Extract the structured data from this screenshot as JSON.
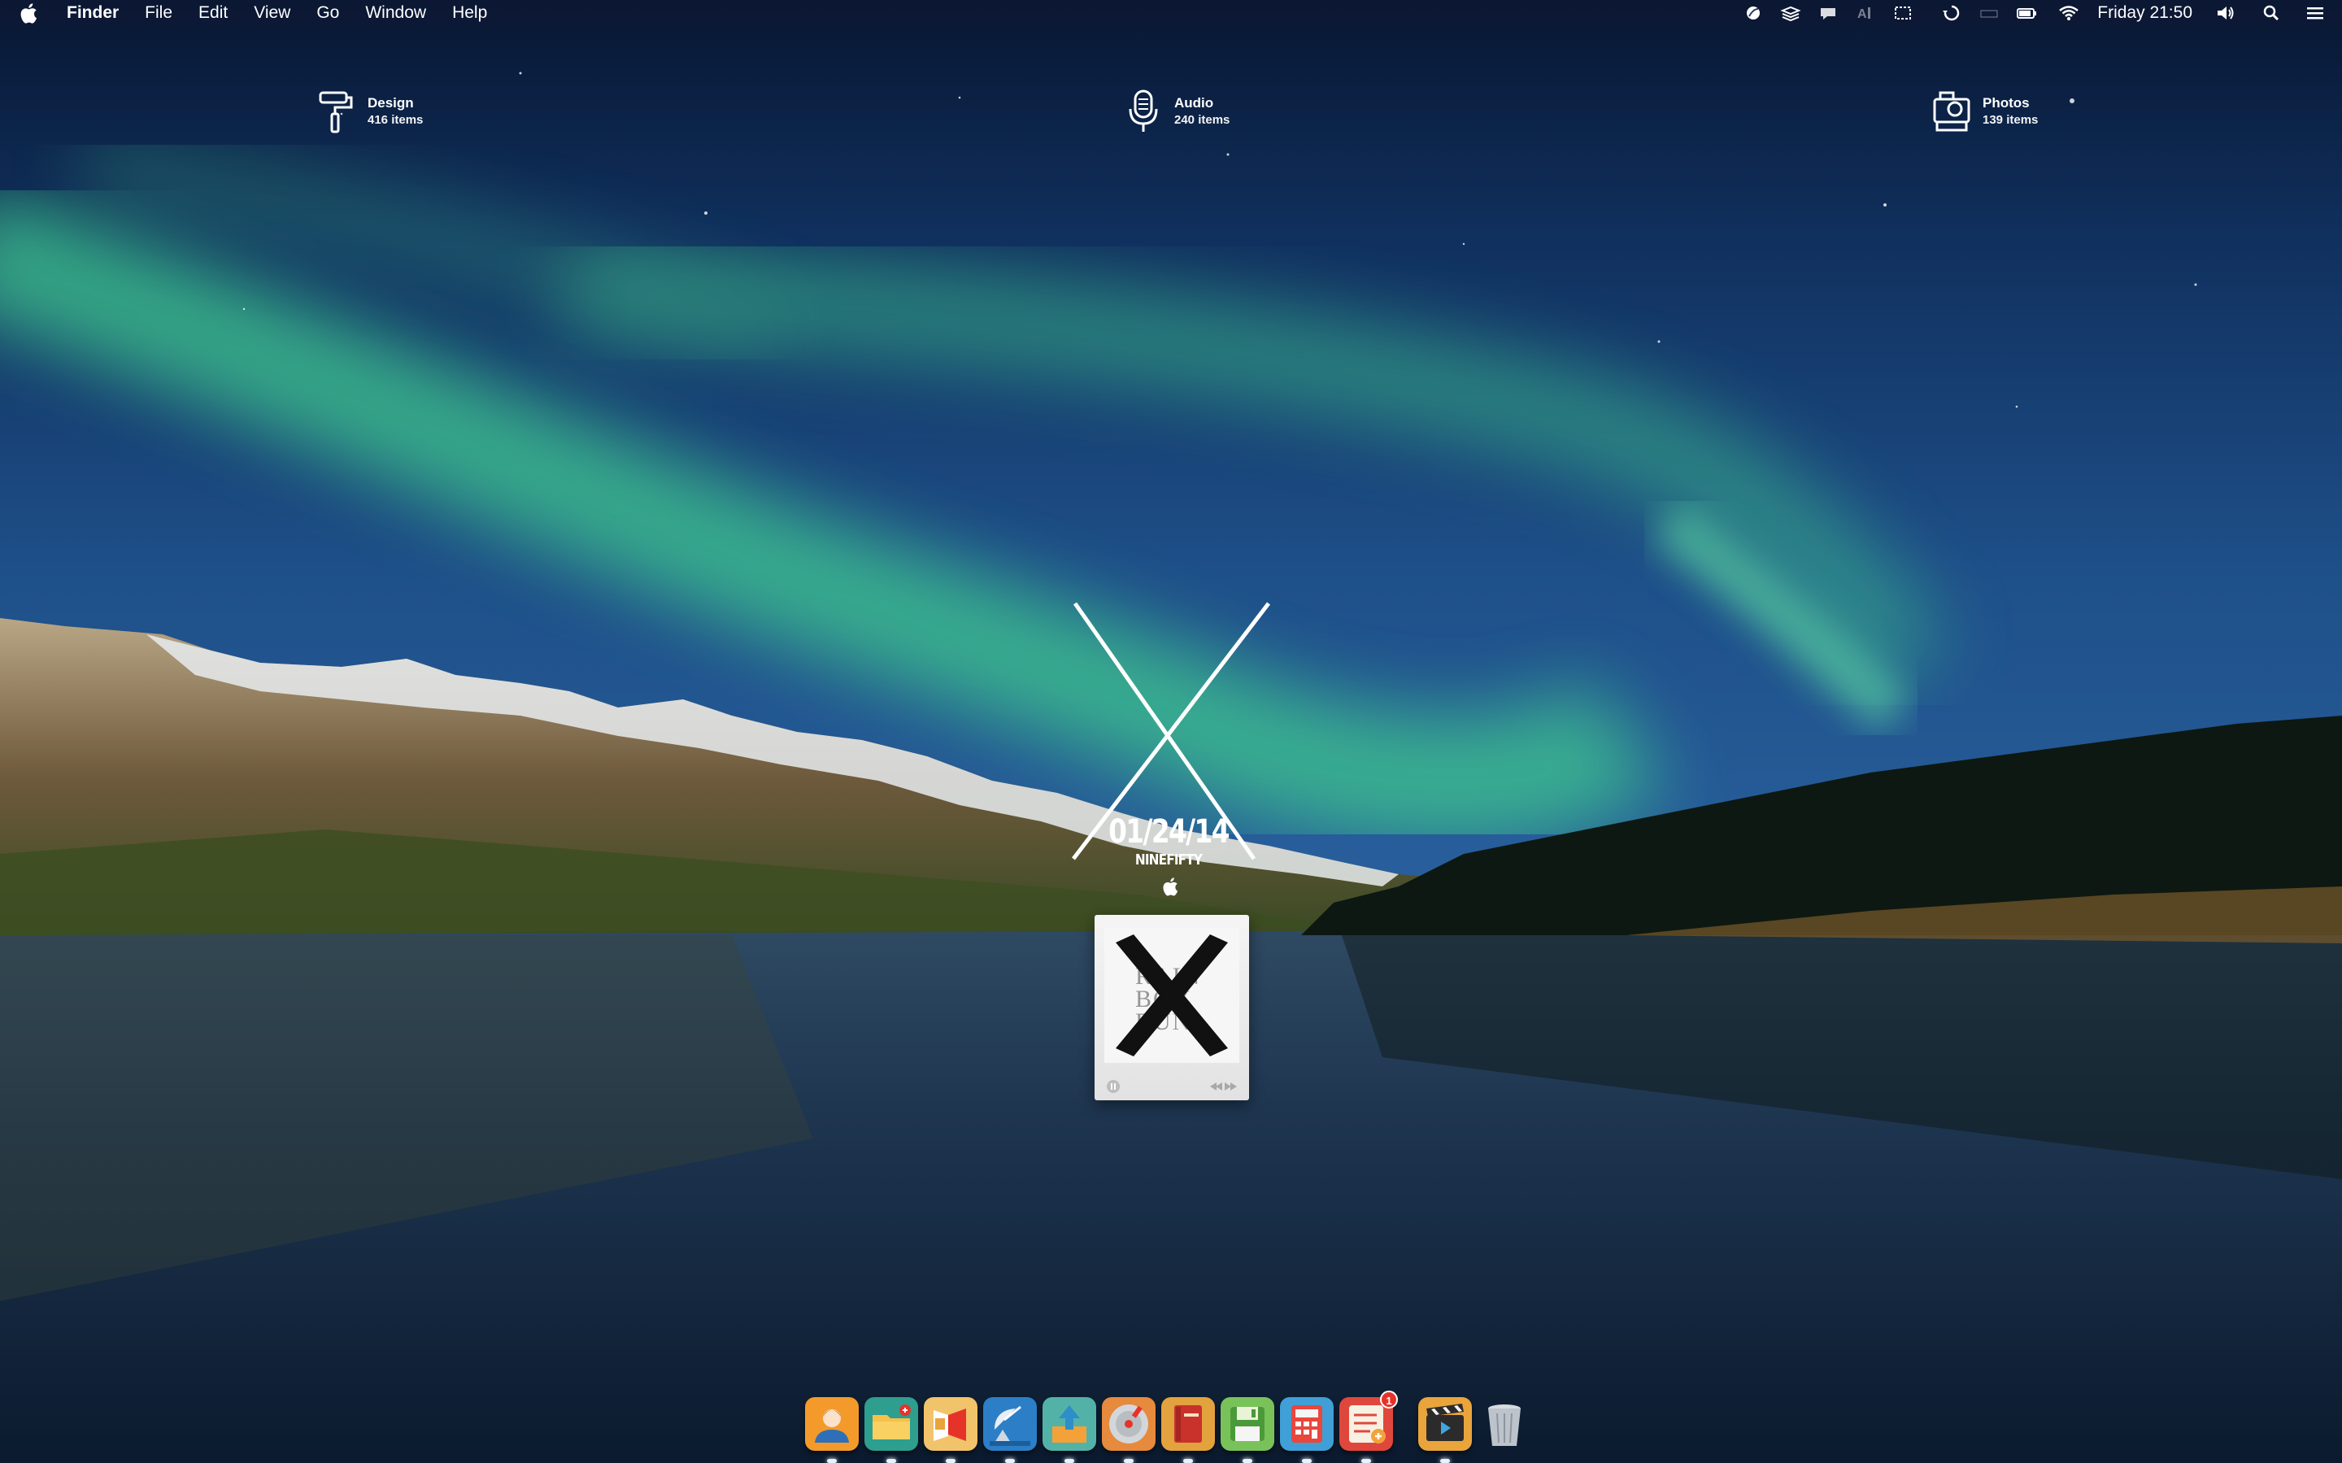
{
  "menubar": {
    "app_name": "Finder",
    "menus": [
      "File",
      "Edit",
      "View",
      "Go",
      "Window",
      "Help"
    ],
    "clock": "Friday 21:50",
    "tray_icons": [
      "leaf-icon",
      "layers-icon",
      "chat-icon",
      "text-icon",
      "selection-icon",
      "time-machine-icon",
      "cpu-meter-icon",
      "battery-icon",
      "wifi-icon",
      "volume-icon",
      "spotlight-icon",
      "notification-center-icon"
    ]
  },
  "stacks": [
    {
      "name": "Design",
      "count": "416 items",
      "icon": "paint-roller-icon"
    },
    {
      "name": "Audio",
      "count": "240 items",
      "icon": "microphone-icon"
    },
    {
      "name": "Photos",
      "count": "139 items",
      "icon": "polaroid-camera-icon"
    }
  ],
  "widget": {
    "date": "01/24/14",
    "time": "NINEFIFTY"
  },
  "player": {
    "album_text": [
      "RAIN",
      "BOY",
      "RUN"
    ]
  },
  "dock": {
    "apps": [
      {
        "icon": "contacts-icon",
        "color": "#f39a2a"
      },
      {
        "icon": "new-folder-icon",
        "color": "#2e9e8e"
      },
      {
        "icon": "announcement-icon",
        "color": "#f1c36a"
      },
      {
        "icon": "satellite-icon",
        "color": "#2c7fc7"
      },
      {
        "icon": "upload-icon",
        "color": "#53b2a8"
      },
      {
        "icon": "disk-utility-icon",
        "color": "#e68a3d"
      },
      {
        "icon": "book-icon",
        "color": "#e2a23e"
      },
      {
        "icon": "save-icon",
        "color": "#79c25a"
      },
      {
        "icon": "calculator-icon",
        "color": "#3f9fd6"
      },
      {
        "icon": "todo-list-icon",
        "color": "#e0473c"
      }
    ],
    "badge_count": "1",
    "extras": [
      {
        "icon": "movie-icon",
        "color": "#e9a43c"
      },
      {
        "icon": "trash-icon",
        "color": "transparent"
      }
    ]
  },
  "colors": {
    "sky_top": "#0a1a3a",
    "aurora": "#3fc98f",
    "lake": "#1c3048"
  }
}
